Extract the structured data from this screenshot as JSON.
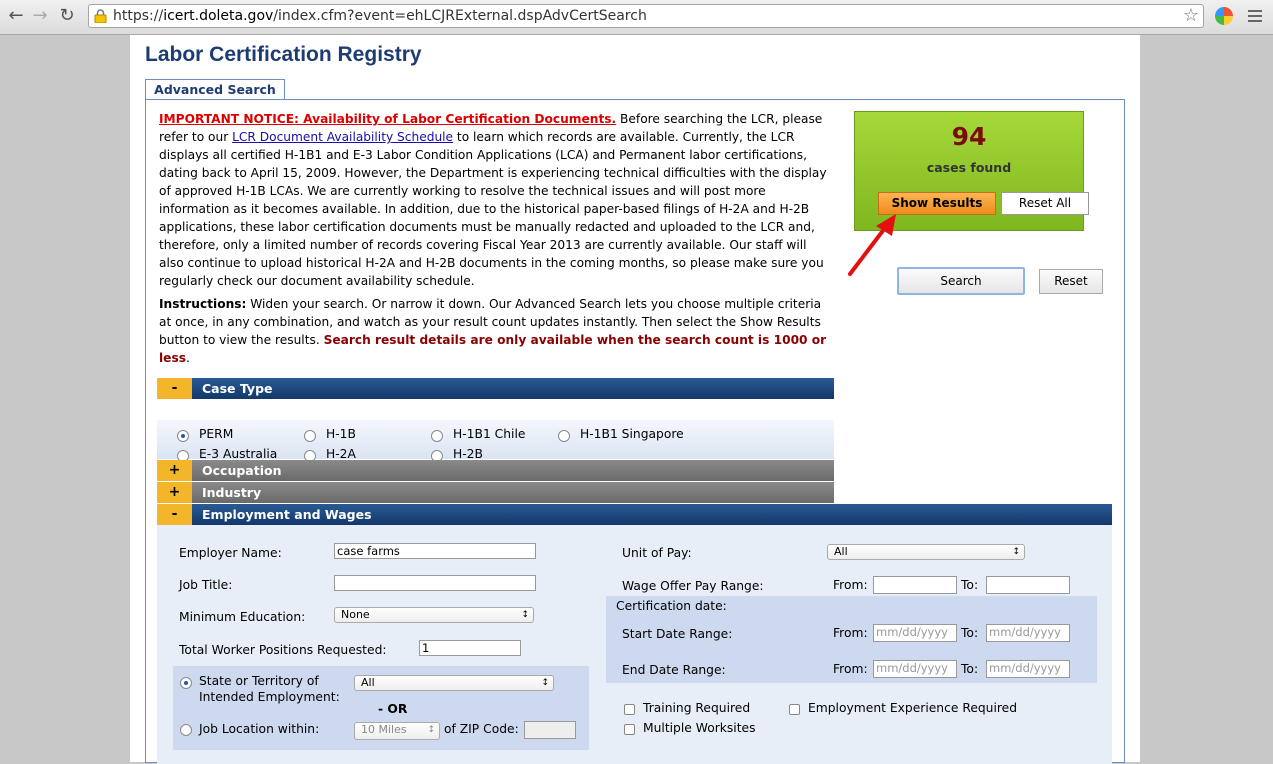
{
  "browser": {
    "url_prefix": "https://",
    "url_host": "icert.doleta.gov",
    "url_path": "/index.cfm?event=ehLCJRExternal.dspAdvCertSearch"
  },
  "page": {
    "title": "Labor Certification Registry",
    "tab": "Advanced Search"
  },
  "notice": {
    "important": "IMPORTANT NOTICE: Availability of Labor Certification Documents.",
    "text1": " Before searching the LCR, please refer to our ",
    "link": "LCR Document Availability Schedule",
    "text2": " to learn which records are available. Currently, the LCR displays all certified H-1B1 and E-3 Labor Condition Applications (LCA) and Permanent labor certifications, dating back to April 15, 2009. However, the Department is experiencing technical difficulties with the display of approved H-1B LCAs. We are currently working to resolve the technical issues and will post more information as it becomes available. In addition, due to the historical paper-based filings of H-2A and H-2B applications, these labor certification documents must be manually redacted and uploaded to the LCR and, therefore, only a limited number of records covering Fiscal Year 2013 are currently available. Our staff will also continue to upload historical H-2A and H-2B documents in the coming months, so please make sure you regularly check our document availability schedule."
  },
  "instructions": {
    "label": "Instructions:",
    "text": " Widen your search. Or narrow it down. Our Advanced Search lets you choose multiple criteria at once, in any combination, and watch as your result count updates instantly. Then select the Show Results button to view the results. ",
    "bold": "Search result details are only available when the search count is 1000 or less",
    "end": "."
  },
  "results": {
    "count": "94",
    "label": "cases found",
    "show_results": "Show Results",
    "reset_all": "Reset All"
  },
  "search_button": "Search",
  "reset_button": "Reset",
  "sections": {
    "case_type": {
      "toggle": "-",
      "label": "Case Type"
    },
    "occupation": {
      "toggle": "+",
      "label": "Occupation"
    },
    "industry": {
      "toggle": "+",
      "label": "Industry"
    },
    "employment": {
      "toggle": "-",
      "label": "Employment and Wages"
    }
  },
  "case_types": [
    "PERM",
    "H-1B",
    "H-1B1 Chile",
    "H-1B1 Singapore",
    "E-3 Australia",
    "H-2A",
    "H-2B"
  ],
  "case_type_selected": "PERM",
  "employment": {
    "employer_name_label": "Employer Name:",
    "employer_name_value": "case farms",
    "job_title_label": "Job Title:",
    "job_title_value": "",
    "min_edu_label": "Minimum Education:",
    "min_edu_value": "None",
    "total_workers_label": "Total Worker Positions Requested:",
    "total_workers_value": "1",
    "state_label_1": "State or Territory of",
    "state_label_2": "Intended Employment:",
    "state_value": "All",
    "or_label": "- OR",
    "job_location_label": "Job Location within:",
    "miles_value": "10 Miles",
    "zip_label": "of ZIP Code:",
    "unit_pay_label": "Unit of Pay:",
    "unit_pay_value": "All",
    "wage_range_label": "Wage Offer Pay Range:",
    "from_label": "From:",
    "to_label": "To:",
    "cert_date_label": "Certification date:",
    "start_range_label": "Start Date Range:",
    "end_range_label": "End Date Range:",
    "date_placeholder": "mm/dd/yyyy",
    "training_required": "Training Required",
    "employment_experience": "Employment Experience Required",
    "multiple_worksites": "Multiple Worksites"
  }
}
